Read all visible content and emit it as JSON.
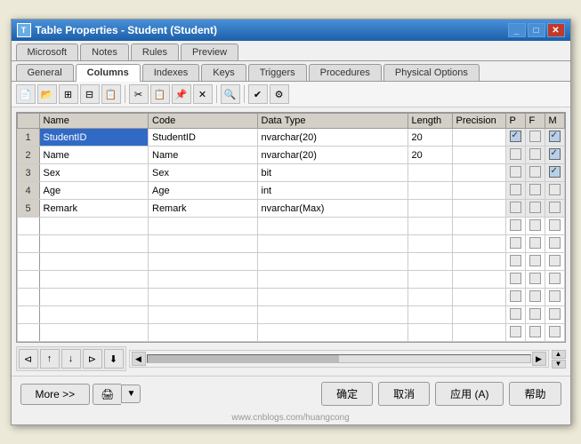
{
  "window": {
    "title": "Table Properties - Student (Student)",
    "icon": "T"
  },
  "tabs_row1": [
    {
      "id": "microsoft",
      "label": "Microsoft",
      "active": false
    },
    {
      "id": "notes",
      "label": "Notes",
      "active": false
    },
    {
      "id": "rules",
      "label": "Rules",
      "active": false
    },
    {
      "id": "preview",
      "label": "Preview",
      "active": false
    }
  ],
  "tabs_row2": [
    {
      "id": "general",
      "label": "General",
      "active": false
    },
    {
      "id": "columns",
      "label": "Columns",
      "active": true
    },
    {
      "id": "indexes",
      "label": "Indexes",
      "active": false
    },
    {
      "id": "keys",
      "label": "Keys",
      "active": false
    },
    {
      "id": "triggers",
      "label": "Triggers",
      "active": false
    },
    {
      "id": "procedures",
      "label": "Procedures",
      "active": false
    },
    {
      "id": "physical",
      "label": "Physical Options",
      "active": false
    }
  ],
  "table": {
    "headers": [
      "",
      "Name",
      "Code",
      "Data Type",
      "Length",
      "Precision",
      "P",
      "F",
      "M"
    ],
    "rows": [
      {
        "num": 1,
        "name": "StudentID",
        "code": "StudentID",
        "datatype": "nvarchar(20)",
        "length": "20",
        "precision": "",
        "p": true,
        "f": false,
        "m": true,
        "selected": true
      },
      {
        "num": 2,
        "name": "Name",
        "code": "Name",
        "datatype": "nvarchar(20)",
        "length": "20",
        "precision": "",
        "p": false,
        "f": false,
        "m": true,
        "selected": false
      },
      {
        "num": 3,
        "name": "Sex",
        "code": "Sex",
        "datatype": "bit",
        "length": "",
        "precision": "",
        "p": false,
        "f": false,
        "m": true,
        "selected": false
      },
      {
        "num": 4,
        "name": "Age",
        "code": "Age",
        "datatype": "int",
        "length": "",
        "precision": "",
        "p": false,
        "f": false,
        "m": false,
        "selected": false
      },
      {
        "num": 5,
        "name": "Remark",
        "code": "Remark",
        "datatype": "nvarchar(Max)",
        "length": "",
        "precision": "",
        "p": false,
        "f": false,
        "m": false,
        "selected": false
      }
    ]
  },
  "footer": {
    "more_label": "More >>",
    "print_icon": "🖨",
    "confirm_label": "确定",
    "cancel_label": "取消",
    "apply_label": "应用 (A)",
    "help_label": "帮助"
  },
  "watermark": "www.cnblogs.com/huangcong"
}
